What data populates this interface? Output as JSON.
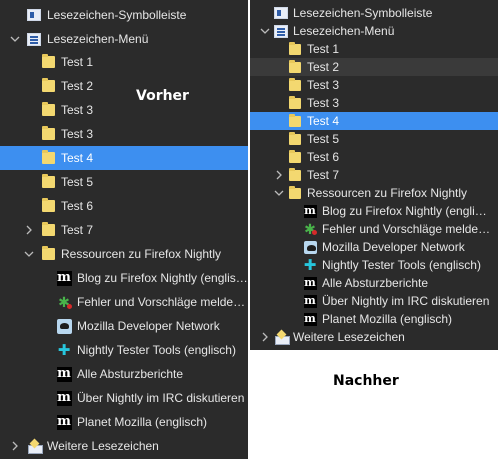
{
  "captions": {
    "before": "Vorher",
    "after": "Nachher"
  },
  "colors": {
    "panel_bg": "#2b2b2b",
    "selection": "#3d8ff0",
    "folder": "#f3d870"
  },
  "before": {
    "toolbar": "Lesezeichen-Symbolleiste",
    "menu": "Lesezeichen-Menü",
    "folders": [
      "Test 1",
      "Test 2",
      "Test 3",
      "Test 3",
      "Test 4",
      "Test 5",
      "Test 6",
      "Test 7"
    ],
    "selected": "Test 4",
    "resources": "Ressourcen zu Firefox Nightly",
    "links": [
      {
        "label": "Blog zu Firefox Nightly (englisch)",
        "icon": "m-icon"
      },
      {
        "label": "Fehler und Vorschläge melden…",
        "icon": "bug-icon"
      },
      {
        "label": "Mozilla Developer Network",
        "icon": "mdn-icon"
      },
      {
        "label": "Nightly Tester Tools (englisch)",
        "icon": "puzzle-icon"
      },
      {
        "label": "Alle Absturzberichte",
        "icon": "m-icon"
      },
      {
        "label": "Über Nightly im IRC diskutieren",
        "icon": "m-icon"
      },
      {
        "label": "Planet Mozilla (englisch)",
        "icon": "m-icon"
      }
    ],
    "other": "Weitere Lesezeichen"
  },
  "after": {
    "toolbar": "Lesezeichen-Symbolleiste",
    "menu": "Lesezeichen-Menü",
    "folders": [
      "Test 1",
      "Test 2",
      "Test 3",
      "Test 3",
      "Test 4",
      "Test 5",
      "Test 6",
      "Test 7"
    ],
    "selected": "Test 4",
    "hovered": "Test 2",
    "resources": "Ressourcen zu Firefox Nightly",
    "links": [
      {
        "label": "Blog zu Firefox Nightly (englisch)",
        "icon": "m-icon"
      },
      {
        "label": "Fehler und Vorschläge melden…",
        "icon": "bug-icon"
      },
      {
        "label": "Mozilla Developer Network",
        "icon": "mdn-icon"
      },
      {
        "label": "Nightly Tester Tools (englisch)",
        "icon": "puzzle-icon"
      },
      {
        "label": "Alle Absturzberichte",
        "icon": "m-icon"
      },
      {
        "label": "Über Nightly im IRC diskutieren",
        "icon": "m-icon"
      },
      {
        "label": "Planet Mozilla (englisch)",
        "icon": "m-icon"
      }
    ],
    "other": "Weitere Lesezeichen"
  }
}
